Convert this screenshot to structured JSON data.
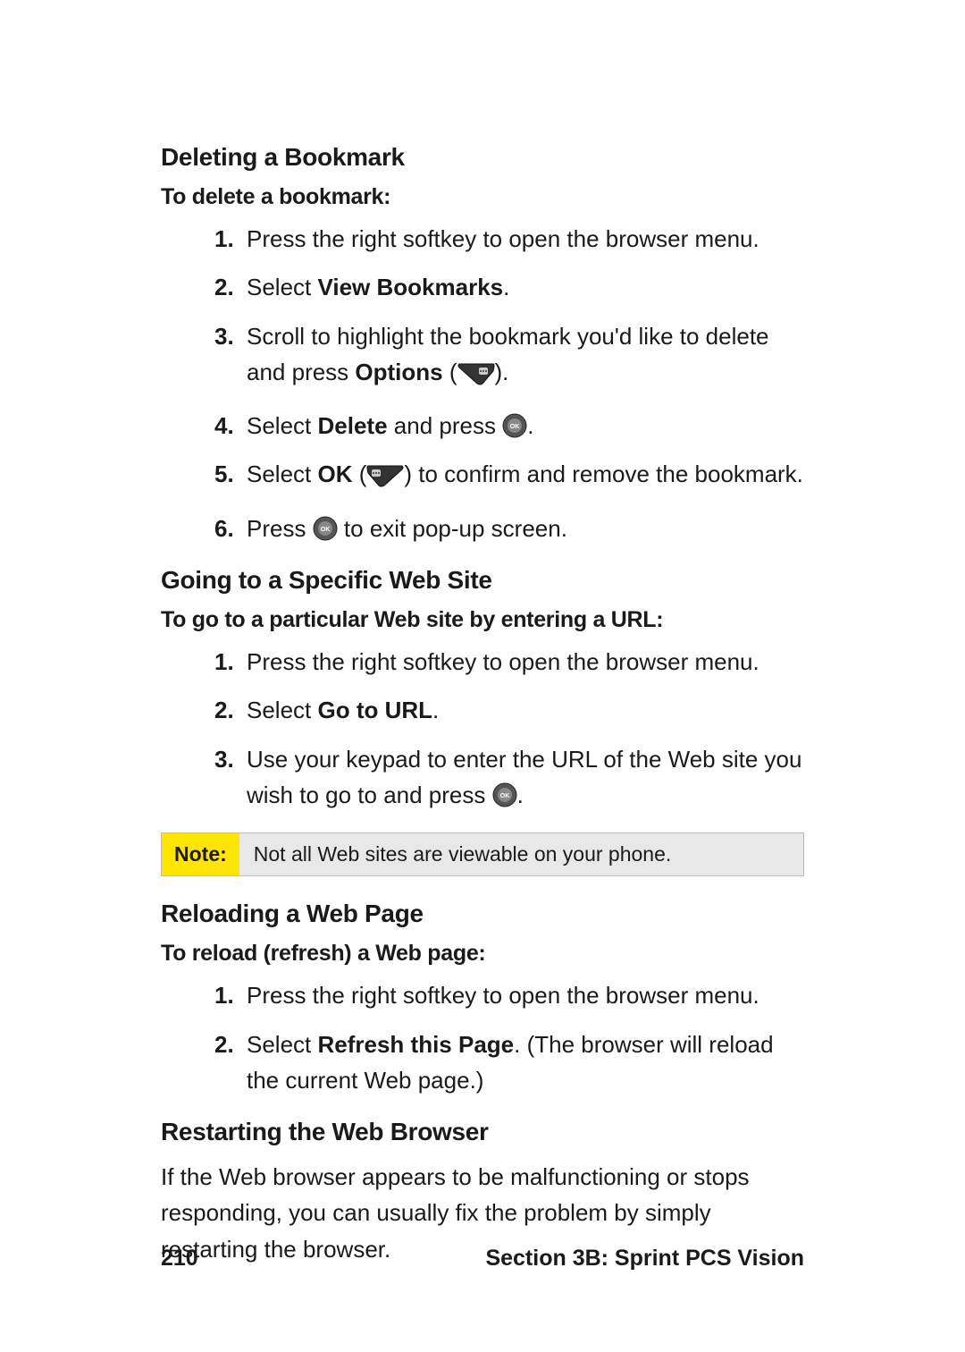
{
  "sections": {
    "deleting": {
      "heading": "Deleting a Bookmark",
      "lead": "To delete a bookmark:",
      "steps": {
        "1": {
          "num": "1.",
          "text": "Press the right softkey to open the browser menu."
        },
        "2": {
          "num": "2.",
          "prefix": "Select ",
          "bold": "View Bookmarks",
          "suffix": "."
        },
        "3": {
          "num": "3.",
          "prefix": "Scroll to highlight the bookmark you'd like to delete and press ",
          "bold": "Options",
          "suffix_a": " (",
          "suffix_b": ")."
        },
        "4": {
          "num": "4.",
          "prefix": "Select ",
          "bold": "Delete",
          "mid": " and press ",
          "suffix": "."
        },
        "5": {
          "num": "5.",
          "prefix": "Select ",
          "bold": "OK",
          "mid_a": " (",
          "mid_b": ") to confirm and remove the bookmark."
        },
        "6": {
          "num": "6.",
          "prefix": "Press ",
          "suffix": " to exit pop-up screen."
        }
      }
    },
    "going": {
      "heading": "Going to a Specific Web Site",
      "lead": "To go to a particular Web site by entering a URL:",
      "steps": {
        "1": {
          "num": "1.",
          "text": "Press the right softkey to open the browser menu."
        },
        "2": {
          "num": "2.",
          "prefix": "Select ",
          "bold": "Go to URL",
          "suffix": "."
        },
        "3": {
          "num": "3.",
          "prefix": "Use your keypad to enter the URL of the Web site you wish to go to and press ",
          "suffix": "."
        }
      }
    },
    "note": {
      "label": "Note:",
      "text": "Not all Web sites are viewable on your phone."
    },
    "reloading": {
      "heading": "Reloading a Web Page",
      "lead": "To reload (refresh) a Web page:",
      "steps": {
        "1": {
          "num": "1.",
          "text": "Press the right softkey to open the browser menu."
        },
        "2": {
          "num": "2.",
          "prefix": "Select ",
          "bold": "Refresh this Page",
          "suffix": ". (The browser will reload the current Web page.)"
        }
      }
    },
    "restarting": {
      "heading": "Restarting the Web Browser",
      "body": "If the Web browser appears to be malfunctioning or stops responding, you can usually fix the problem by simply restarting the browser."
    }
  },
  "footer": {
    "page_number": "210",
    "section_label": "Section 3B: Sprint PCS Vision"
  }
}
